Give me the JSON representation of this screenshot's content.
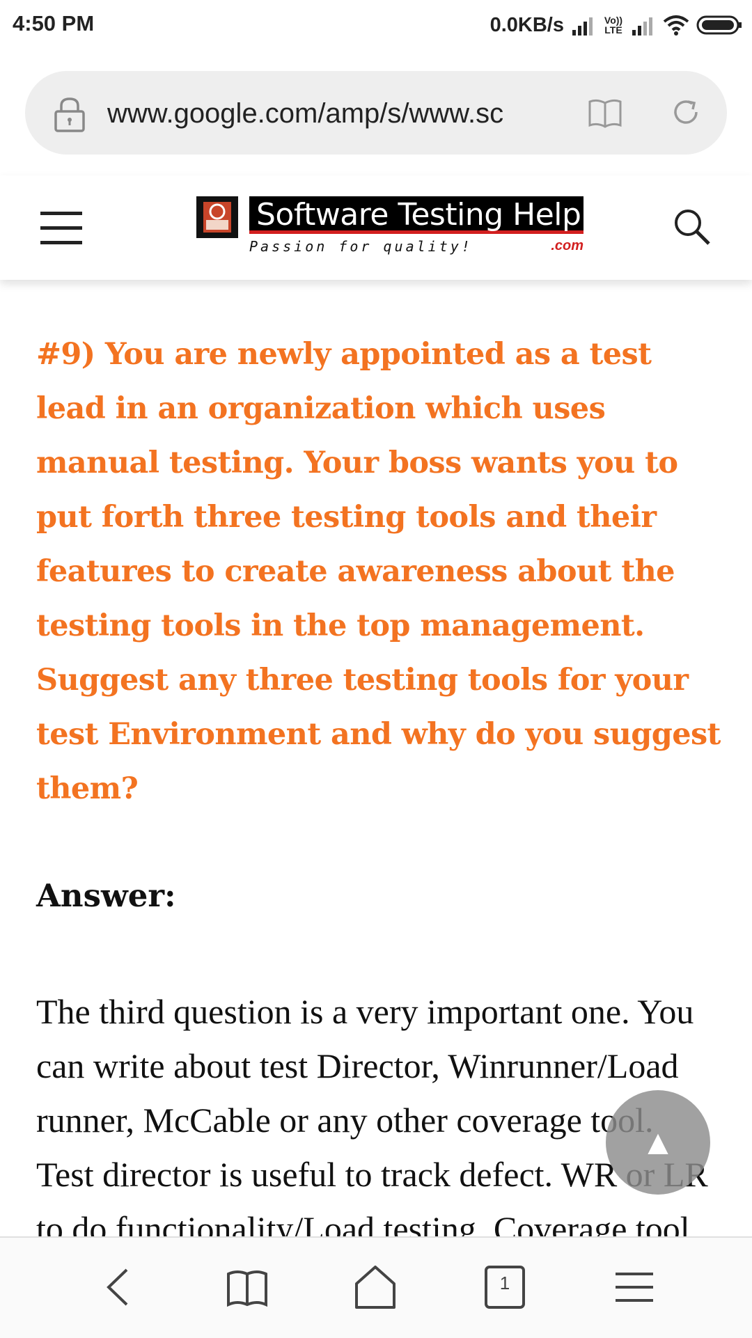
{
  "status_bar": {
    "time": "4:50 PM",
    "net_speed": "0.0KB/s",
    "lte_top": "Vo))",
    "lte_bottom": "LTE"
  },
  "browser": {
    "url": "www.google.com/amp/s/www.sc",
    "lock_icon": "lock-icon",
    "reader_icon": "book-icon",
    "refresh_icon": "refresh-icon"
  },
  "site_header": {
    "logo_title": "Software Testing Help",
    "logo_tagline": "Passion for quality!",
    "logo_domain": ".com",
    "menu_icon": "hamburger-icon",
    "search_icon": "search-icon"
  },
  "article": {
    "question": "#9) You are newly appointed as a test lead in an organization which uses manual testing. Your boss wants you to put forth three testing tools and their features to create awareness about the testing tools in the top management. Suggest any three testing tools for your test Environment and why do you suggest them?",
    "answer_label": "Answer:",
    "answer_body": "The third question is a very important one. You can write about test Director, Winrunner/Load runner, McCable or any other coverage tool. Test director is useful to track defect. WR or LR to do functionality/Load testing. Coverage tool to"
  },
  "scroll_top": {
    "glyph": "▲"
  },
  "bottom_nav": {
    "tabs_count": "1",
    "items": [
      "back-icon",
      "bookmarks-icon",
      "home-icon",
      "tabs-icon",
      "menu-icon"
    ]
  },
  "colors": {
    "question": "#f37321",
    "logo_red": "#d21f1f",
    "pill_bg": "#eeeeee"
  }
}
